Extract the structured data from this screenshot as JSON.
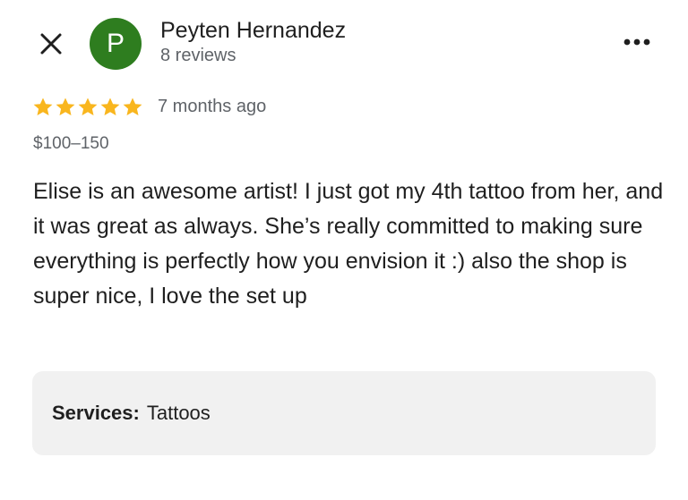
{
  "header": {
    "close_icon": "close-icon",
    "more_icon": "more-horizontal-icon"
  },
  "reviewer": {
    "avatar_letter": "P",
    "avatar_color": "#2e7d1f",
    "name": "Peyten Hernandez",
    "review_count": "8 reviews"
  },
  "review": {
    "rating": 5,
    "rating_max": 5,
    "star_color": "#f9b61e",
    "time_ago": "7 months ago",
    "price_range": "$100–150",
    "text": "Elise is an awesome artist! I just got my 4th tattoo from her, and it was great as always. She’s really committed to making sure everything is perfectly how you envision it :) also the shop is super nice, I love the set up"
  },
  "services": {
    "label": "Services:",
    "value": "Tattoos"
  }
}
